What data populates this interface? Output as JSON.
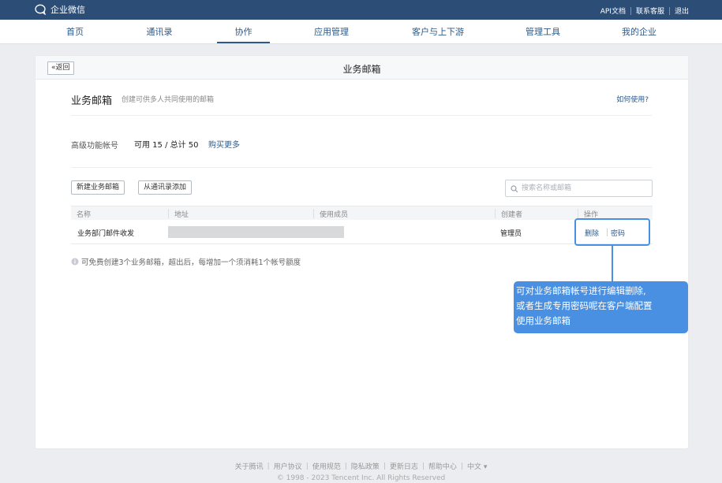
{
  "topbar": {
    "brand": "企业微信",
    "links": [
      "API文档",
      "联系客服",
      "退出"
    ]
  },
  "nav": {
    "items": [
      "首页",
      "通讯录",
      "协作",
      "应用管理",
      "客户与上下游",
      "管理工具",
      "我的企业"
    ],
    "active": "协作"
  },
  "card": {
    "back_label": "返回",
    "title": "业务邮箱"
  },
  "section": {
    "title": "业务邮箱",
    "desc": "创建可供多人共同使用的邮箱",
    "help_link": "如何使用?"
  },
  "quota": {
    "label": "高级功能帐号",
    "value": "可用 15 / 总计 50",
    "buy_link": "购买更多"
  },
  "toolbar": {
    "new_button": "新建业务邮箱",
    "from_contacts_button": "从通讯录添加",
    "search_placeholder": "搜索名称或邮箱"
  },
  "table": {
    "headers": [
      "名称",
      "地址",
      "使用成员",
      "创建者",
      "操作"
    ],
    "rows": [
      {
        "name": "业务部门邮件收发",
        "address": "",
        "members": "",
        "creator": "管理员",
        "ops": [
          "删除",
          "密码"
        ]
      }
    ]
  },
  "note": "可免费创建3个业务邮箱，超出后，每增加一个须消耗1个帐号额度",
  "tooltip": {
    "lines": [
      "可对业务邮箱帐号进行编辑删除,",
      "或者生成专用密码呢在客户端配置",
      "使用业务邮箱"
    ]
  },
  "footer": {
    "links": [
      "关于腾讯",
      "用户协议",
      "使用规范",
      "隐私政策",
      "更新日志",
      "帮助中心",
      "中文 ▾"
    ],
    "copyright": "© 1998 - 2023 Tencent Inc. All Rights Reserved"
  },
  "colors": {
    "topbar": "#2c4d75",
    "link": "#2d5a8a",
    "highlight": "#4a90e2"
  }
}
